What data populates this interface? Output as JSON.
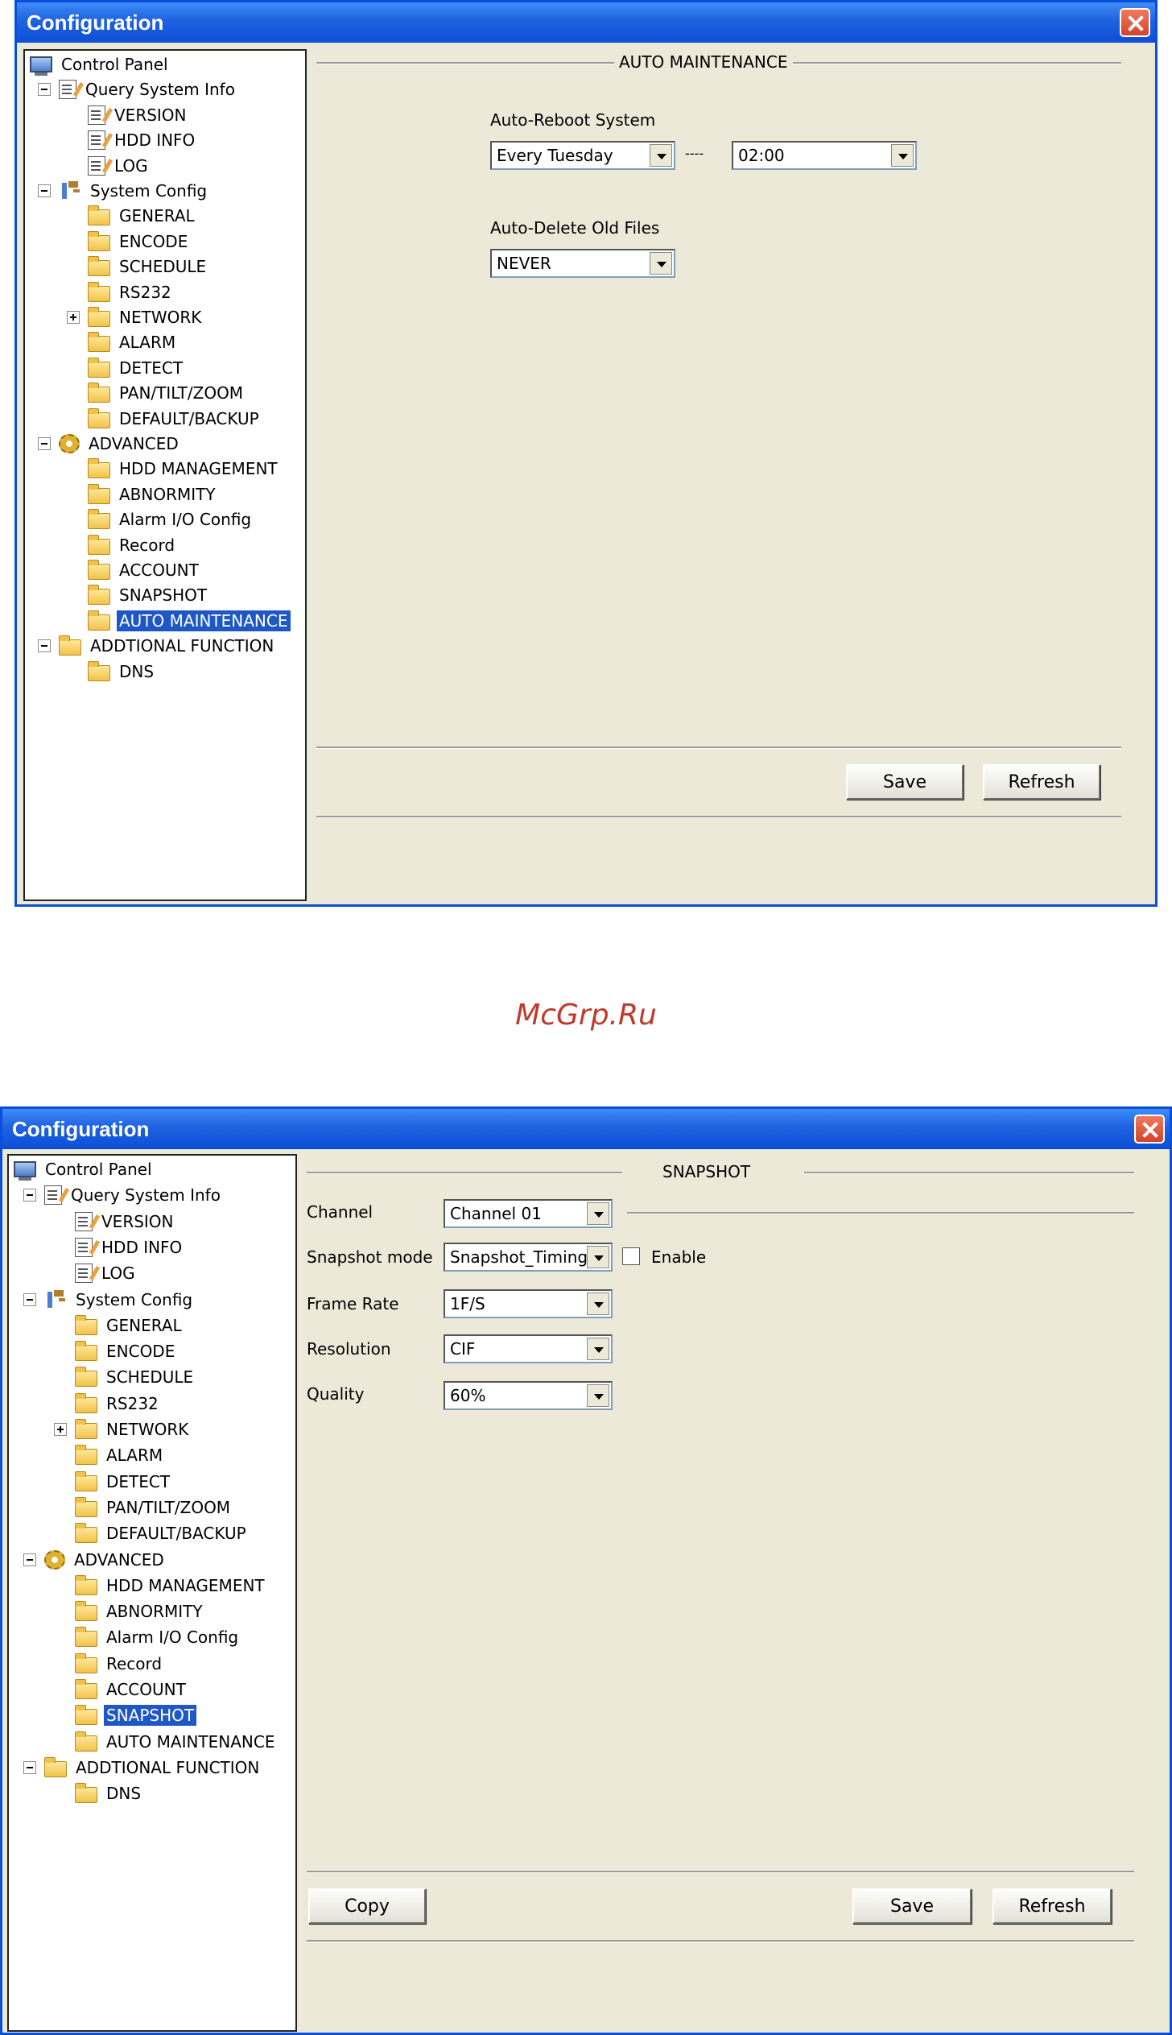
{
  "window1": {
    "title": "Configuration",
    "tree": [
      {
        "label": "Control Panel",
        "icon": "monitor-icon"
      },
      {
        "label": "Query System Info",
        "icon": "document-icon"
      },
      {
        "label": "VERSION",
        "icon": "document-icon"
      },
      {
        "label": "HDD INFO",
        "icon": "document-icon"
      },
      {
        "label": "LOG",
        "icon": "document-icon"
      },
      {
        "label": "System Config",
        "icon": "tools-icon"
      },
      {
        "label": "GENERAL",
        "icon": "folder-icon"
      },
      {
        "label": "ENCODE",
        "icon": "folder-icon"
      },
      {
        "label": "SCHEDULE",
        "icon": "folder-icon"
      },
      {
        "label": "RS232",
        "icon": "folder-icon"
      },
      {
        "label": "NETWORK",
        "icon": "folder-icon"
      },
      {
        "label": "ALARM",
        "icon": "folder-icon"
      },
      {
        "label": "DETECT",
        "icon": "folder-icon"
      },
      {
        "label": "PAN/TILT/ZOOM",
        "icon": "folder-icon"
      },
      {
        "label": "DEFAULT/BACKUP",
        "icon": "folder-icon"
      },
      {
        "label": "ADVANCED",
        "icon": "gears-icon"
      },
      {
        "label": "HDD MANAGEMENT",
        "icon": "folder-icon"
      },
      {
        "label": "ABNORMITY",
        "icon": "folder-icon"
      },
      {
        "label": "Alarm I/O Config",
        "icon": "folder-icon"
      },
      {
        "label": "Record",
        "icon": "folder-icon"
      },
      {
        "label": "ACCOUNT",
        "icon": "folder-icon"
      },
      {
        "label": "SNAPSHOT",
        "icon": "folder-icon"
      },
      {
        "label": "AUTO MAINTENANCE",
        "icon": "folder-icon"
      },
      {
        "label": "ADDTIONAL FUNCTION",
        "icon": "folder-icon"
      },
      {
        "label": "DNS",
        "icon": "folder-icon"
      }
    ],
    "selected_item": "AUTO MAINTENANCE",
    "panel": {
      "group_title": "AUTO MAINTENANCE",
      "auto_reboot_label": "Auto-Reboot System",
      "reboot_day": "Every Tuesday",
      "separator": "----",
      "reboot_time": "02:00",
      "auto_delete_label": "Auto-Delete Old Files",
      "delete_value": "NEVER",
      "save_label": "Save",
      "refresh_label": "Refresh"
    }
  },
  "watermark": "McGrp.Ru",
  "window2": {
    "title": "Configuration",
    "selected_item": "SNAPSHOT",
    "panel": {
      "group_title": "SNAPSHOT",
      "channel_label": "Channel",
      "channel_value": "Channel 01",
      "snapshot_mode_label": "Snapshot mode",
      "snapshot_mode_value": "Snapshot_Timing",
      "enable_label": "Enable",
      "enable_checked": false,
      "frame_rate_label": "Frame Rate",
      "frame_rate_value": "1F/S",
      "resolution_label": "Resolution",
      "resolution_value": "CIF",
      "quality_label": "Quality",
      "quality_value": "60%",
      "copy_label": "Copy",
      "save_label": "Save",
      "refresh_label": "Refresh"
    }
  }
}
